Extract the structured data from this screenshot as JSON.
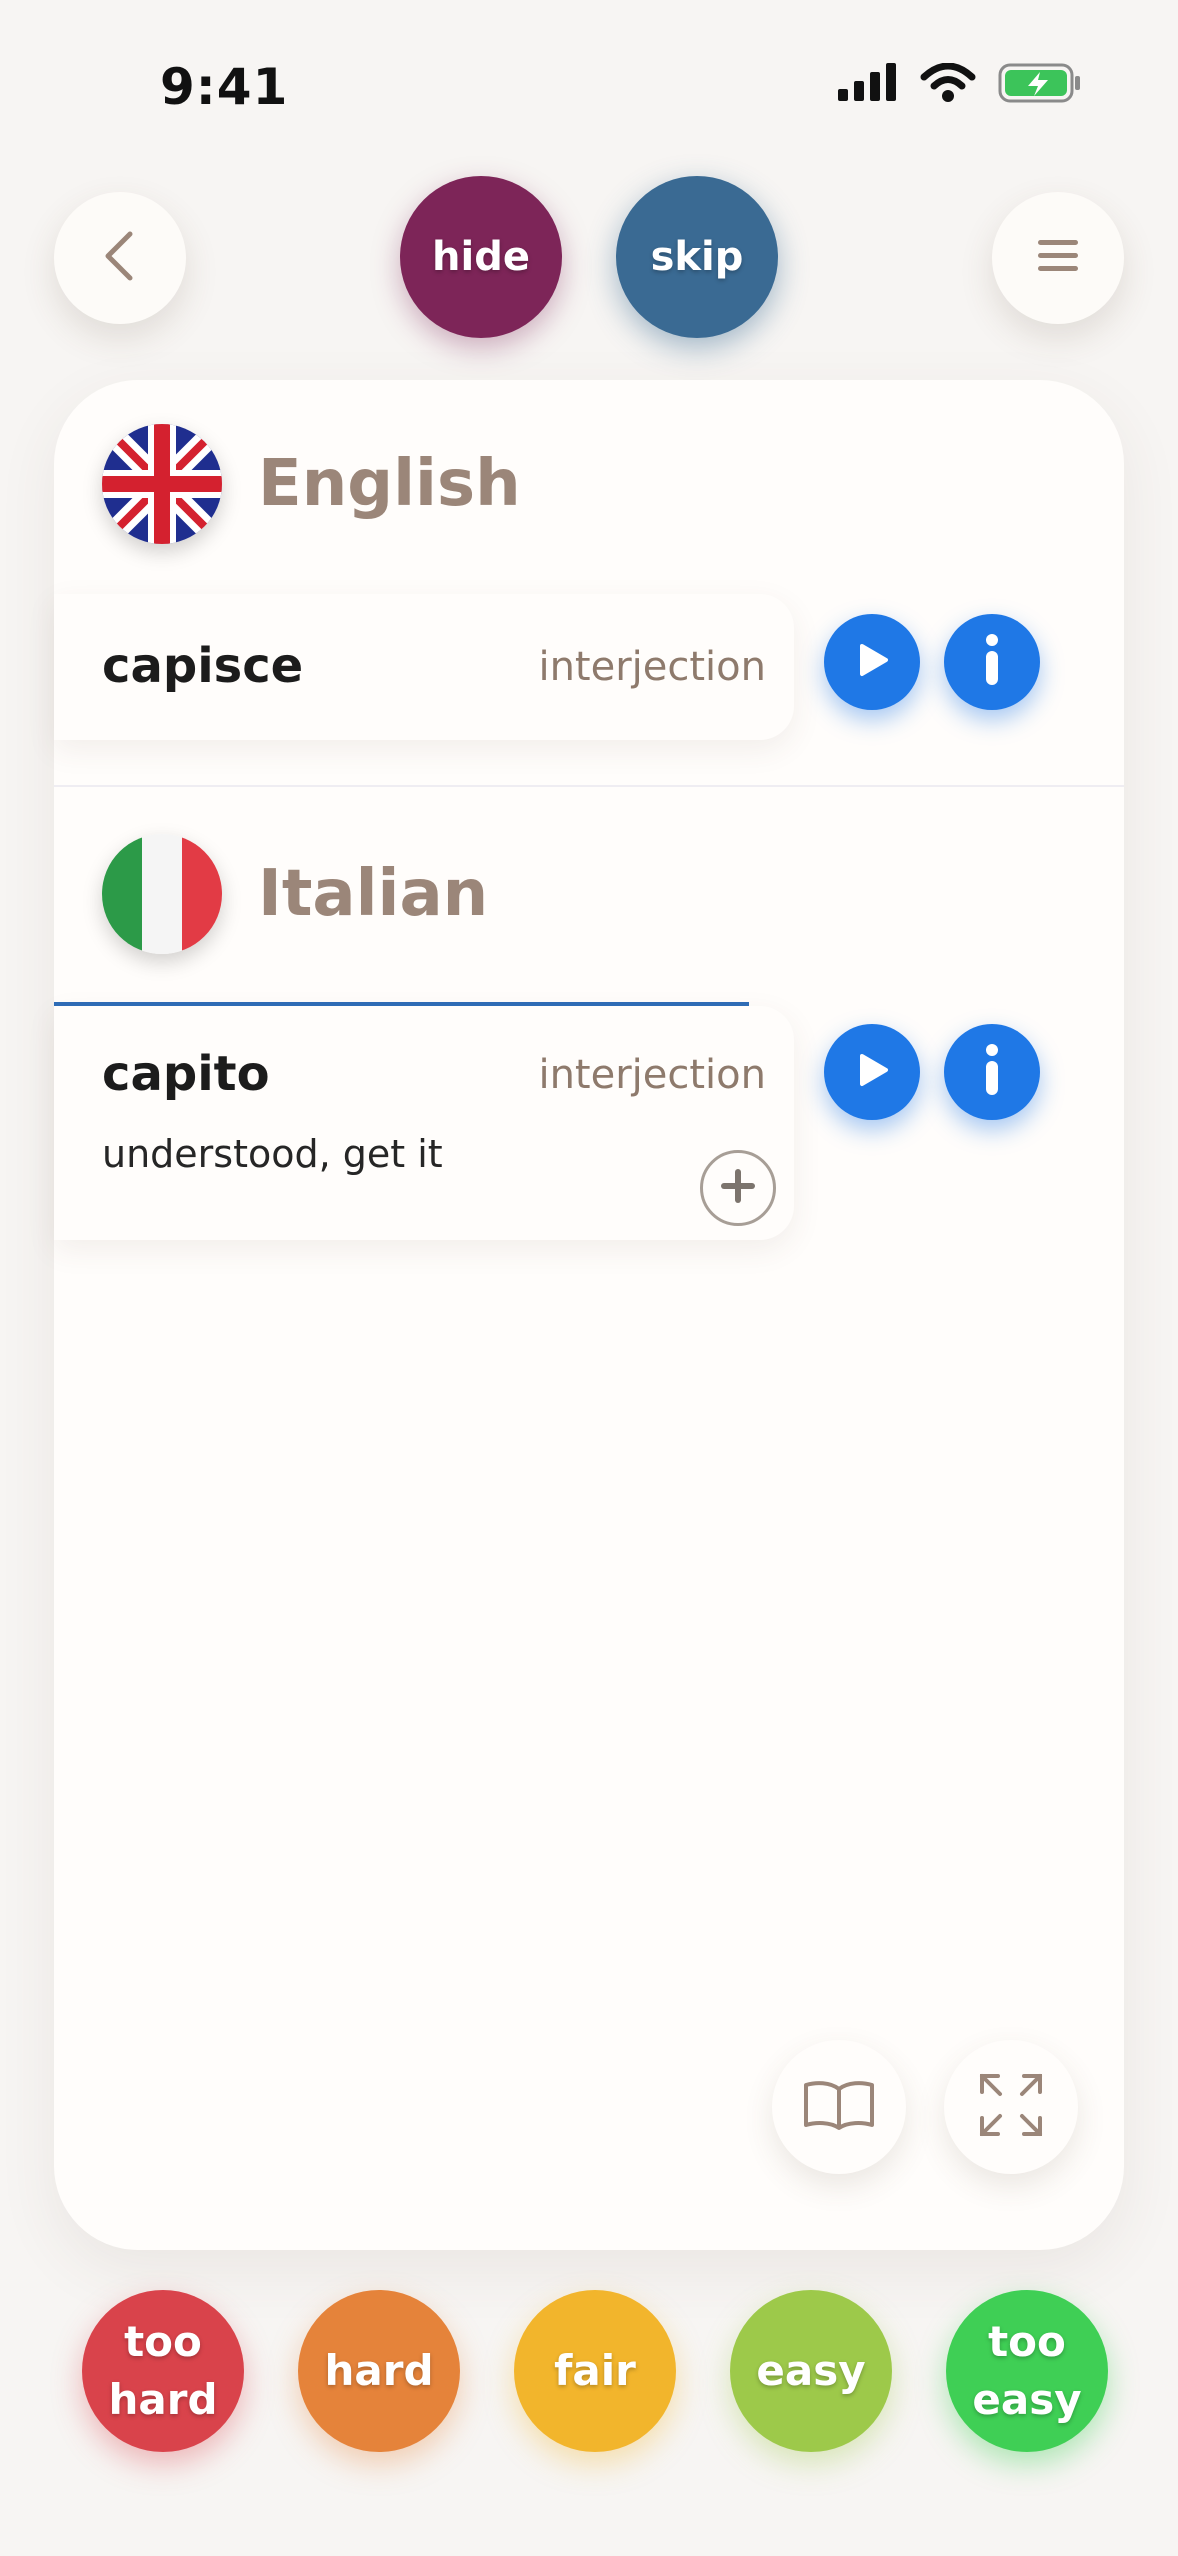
{
  "status_bar": {
    "time": "9:41"
  },
  "top_bar": {
    "hide_label": "hide",
    "skip_label": "skip"
  },
  "english": {
    "language": "English",
    "word": "capisce",
    "part_of_speech": "interjection"
  },
  "italian": {
    "language": "Italian",
    "word": "capito",
    "part_of_speech": "interjection",
    "translation": "understood, get it"
  },
  "ratings": [
    {
      "line1": "too",
      "line2": "hard",
      "color": "#d9434b"
    },
    {
      "line1": "hard",
      "line2": "",
      "color": "#e5833a"
    },
    {
      "line1": "fair",
      "line2": "",
      "color": "#f2b52c"
    },
    {
      "line1": "easy",
      "line2": "",
      "color": "#9dc94a"
    },
    {
      "line1": "too",
      "line2": "easy",
      "color": "#3fcf55"
    }
  ],
  "icons": {
    "back": "chevron-left-icon",
    "menu": "hamburger-menu-icon",
    "play": "play-icon",
    "info": "info-icon",
    "add": "plus-icon",
    "book": "open-book-icon",
    "expand": "expand-icon",
    "signal": "cellular-signal-icon",
    "wifi": "wifi-icon",
    "battery": "battery-charging-icon"
  }
}
